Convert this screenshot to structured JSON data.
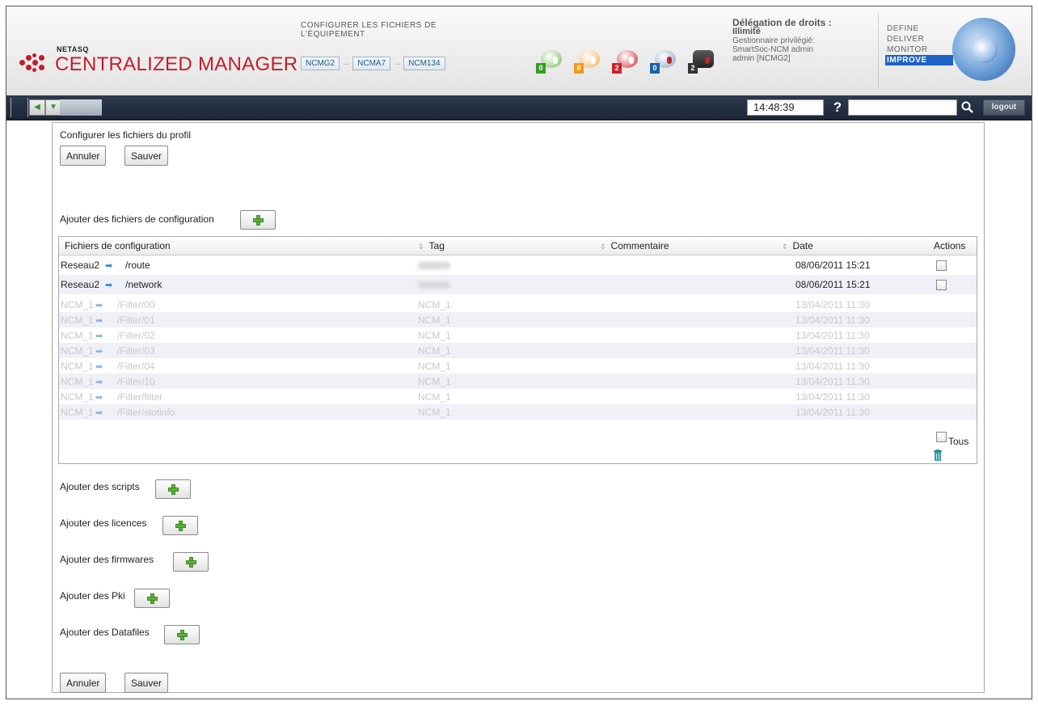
{
  "header": {
    "logo_small": "NETASQ",
    "logo_big": "CENTRALIZED MANAGER",
    "page_title": "CONFIGURER LES FICHIERS DE L'ÉQUIPEMENT",
    "breadcrumbs": [
      "NCMG2",
      "NCMA7",
      "NCM134"
    ],
    "alarms": [
      {
        "count": "0",
        "color": "#3a9a2a"
      },
      {
        "count": "0",
        "color": "#f29a1a"
      },
      {
        "count": "2",
        "color": "#c8242a"
      },
      {
        "count": "0",
        "color": "#1e5fa8"
      },
      {
        "count": "2",
        "color": "#333333"
      }
    ],
    "delegation_title": "Délégation de droits :",
    "delegation_value": "Illimité",
    "role": "Gestionnaire privilégié:",
    "user_line1": "SmartSoc-NCM admin",
    "user_line2": "admin [NCMG2]",
    "cycle": [
      "DEFINE",
      "DELIVER",
      "MONITOR",
      "IMPROVE"
    ],
    "cycle_active": "IMPROVE"
  },
  "toolbar": {
    "clock": "14:48:39",
    "help": "?",
    "search_value": "",
    "logout": "logout"
  },
  "main": {
    "title": "Configurer les fichiers du profil",
    "cancel": "Annuler",
    "save": "Sauver",
    "add_config_label": "Ajouter des fichiers de configuration",
    "table": {
      "columns": [
        "Fichiers de configuration",
        "Tag",
        "Commentaire",
        "Date",
        "Actions"
      ],
      "rows": [
        {
          "device": "Reseau2",
          "path": "/route",
          "tag": "",
          "comment": "",
          "date": "08/06/2011 15:21",
          "editable": true
        },
        {
          "device": "Reseau2",
          "path": "/network",
          "tag": "",
          "comment": "",
          "date": "08/06/2011 15:21",
          "editable": true
        },
        {
          "device": "NCM_1",
          "path": "/Filter/00",
          "tag": "NCM_1",
          "comment": "",
          "date": "13/04/2011 11:30",
          "editable": false
        },
        {
          "device": "NCM_1",
          "path": "/Filter/01",
          "tag": "NCM_1",
          "comment": "",
          "date": "13/04/2011 11:30",
          "editable": false
        },
        {
          "device": "NCM_1",
          "path": "/Filter/02",
          "tag": "NCM_1",
          "comment": "",
          "date": "13/04/2011 11:30",
          "editable": false
        },
        {
          "device": "NCM_1",
          "path": "/Filter/03",
          "tag": "NCM_1",
          "comment": "",
          "date": "13/04/2011 11:30",
          "editable": false
        },
        {
          "device": "NCM_1",
          "path": "/Filter/04",
          "tag": "NCM_1",
          "comment": "",
          "date": "13/04/2011 11:30",
          "editable": false
        },
        {
          "device": "NCM_1",
          "path": "/Filter/10",
          "tag": "NCM_1",
          "comment": "",
          "date": "13/04/2011 11:30",
          "editable": false
        },
        {
          "device": "NCM_1",
          "path": "/Filter/filter",
          "tag": "NCM_1",
          "comment": "",
          "date": "13/04/2011 11:30",
          "editable": false
        },
        {
          "device": "NCM_1",
          "path": "/Filter/slotinfo",
          "tag": "NCM_1",
          "comment": "",
          "date": "13/04/2011 11:30",
          "editable": false
        }
      ],
      "select_all_label": "Tous"
    },
    "sections": [
      {
        "label": "Ajouter des scripts"
      },
      {
        "label": "Ajouter des licences"
      },
      {
        "label": "Ajouter des firmwares"
      },
      {
        "label": "Ajouter des Pki"
      },
      {
        "label": "Ajouter des Datafiles"
      }
    ]
  }
}
